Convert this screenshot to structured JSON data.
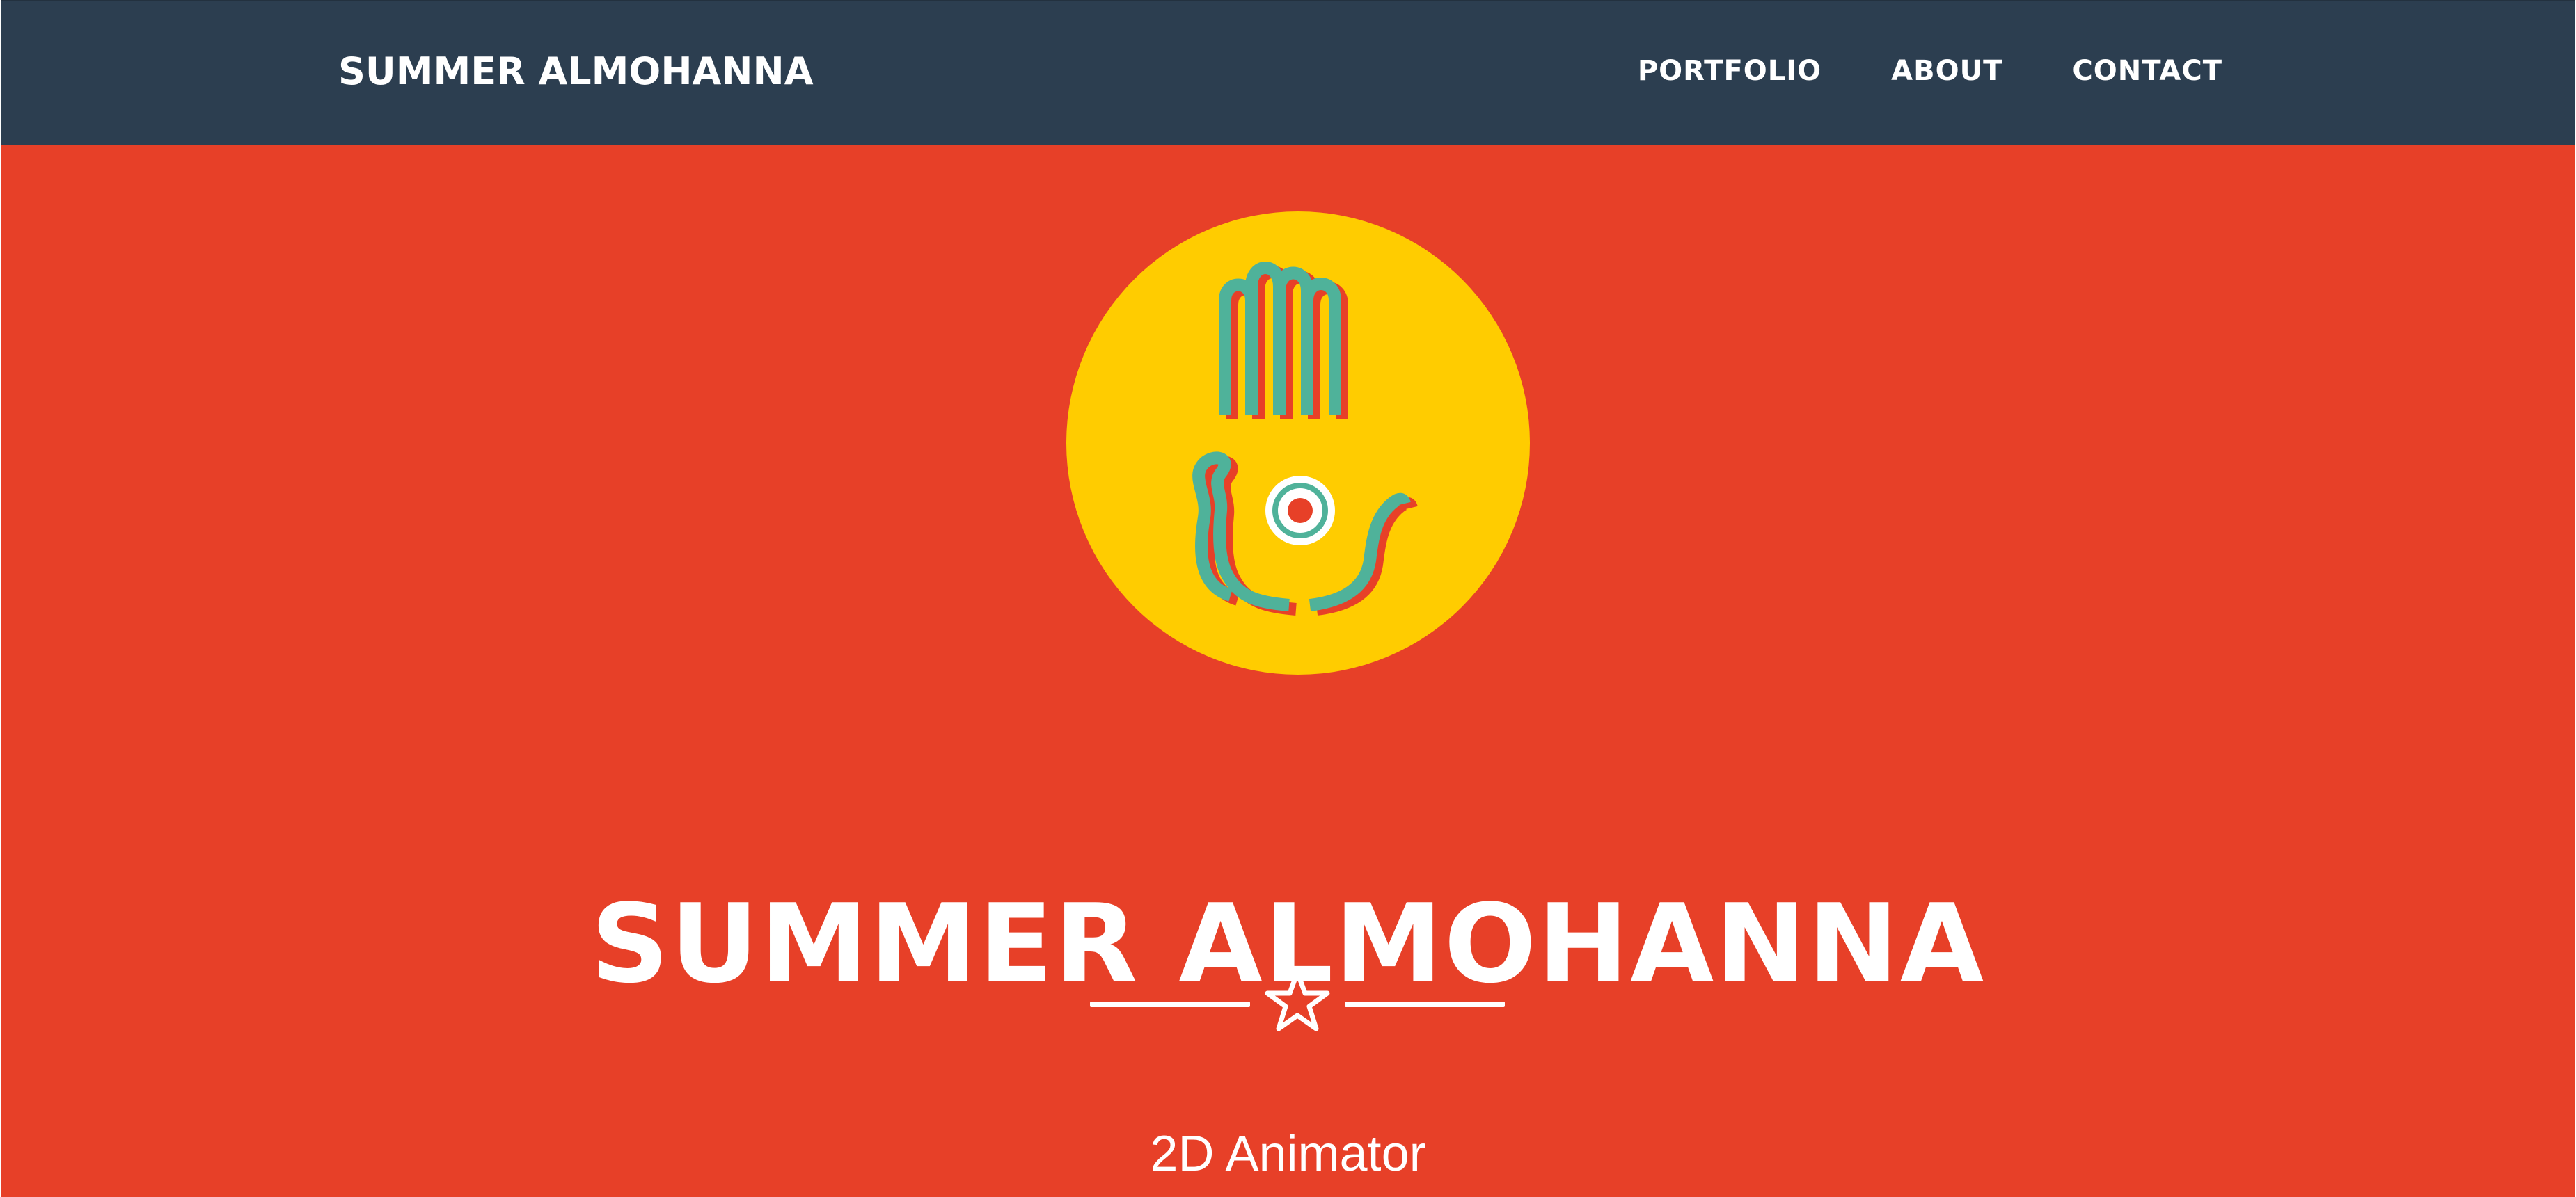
{
  "header": {
    "brand": "SUMMER ALMOHANNA",
    "nav": [
      {
        "label": "PORTFOLIO"
      },
      {
        "label": "ABOUT"
      },
      {
        "label": "CONTACT"
      }
    ]
  },
  "hero": {
    "logo_icon": "hamsa-hand-icon",
    "title": "SUMMER ALMOHANNA",
    "divider_icon": "star-icon",
    "subtitle": "2D Animator"
  },
  "colors": {
    "navbar_bg": "#2c3e50",
    "hero_bg": "#e74028",
    "logo_circle": "#ffcc00",
    "logo_teal": "#4fb29a",
    "logo_red": "#e74028",
    "text": "#ffffff"
  }
}
